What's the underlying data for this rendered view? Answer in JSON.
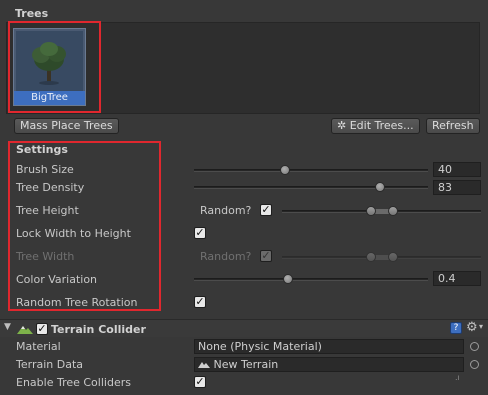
{
  "trees": {
    "section_title": "Trees",
    "items": [
      {
        "label": "BigTree"
      }
    ],
    "mass_place_label": "Mass Place Trees",
    "edit_trees_label": "Edit Trees...",
    "refresh_label": "Refresh"
  },
  "settings": {
    "section_title": "Settings",
    "brush_size": {
      "label": "Brush Size",
      "value": "40",
      "fraction": 0.4
    },
    "tree_density": {
      "label": "Tree Density",
      "value": "83",
      "fraction": 0.83
    },
    "tree_height": {
      "label": "Tree Height",
      "random_label": "Random?",
      "random_checked": true,
      "min": 0.43,
      "max": 0.56
    },
    "lock_width": {
      "label": "Lock Width to Height",
      "checked": true
    },
    "tree_width": {
      "label": "Tree Width",
      "random_label": "Random?",
      "random_checked": true,
      "disabled": true
    },
    "color_variation": {
      "label": "Color Variation",
      "value": "0.4",
      "fraction": 0.4
    },
    "random_rotation": {
      "label": "Random Tree Rotation",
      "checked": true
    }
  },
  "terrain_collider": {
    "title": "Terrain Collider",
    "enabled": true,
    "material": {
      "label": "Material",
      "value": "None (Physic Material)"
    },
    "terrain_data": {
      "label": "Terrain Data",
      "value": "New Terrain"
    },
    "enable_tree_colliders": {
      "label": "Enable Tree Colliders",
      "checked": true
    }
  },
  "colors": {
    "background": "#383838",
    "highlight_box": "#e0272e",
    "selection": "#3d6ebf"
  }
}
